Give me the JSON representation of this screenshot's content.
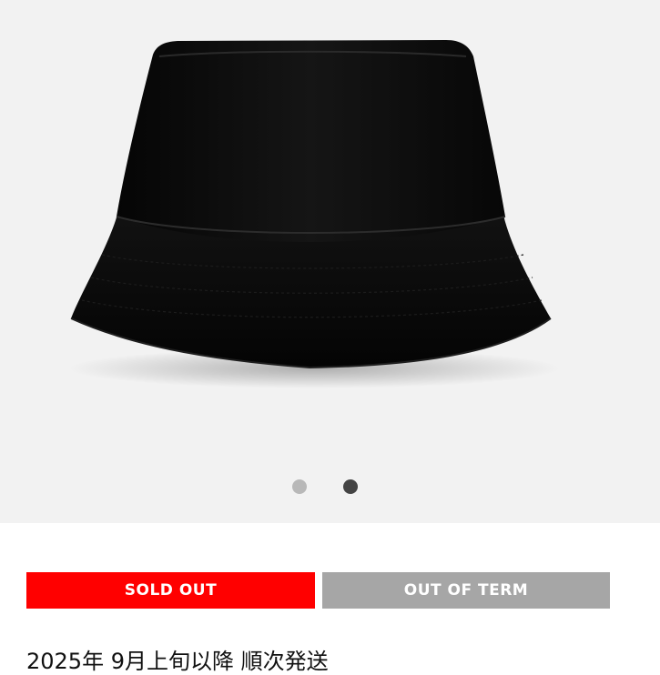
{
  "product": {
    "image_alt": "black bucket hat",
    "image_count": 2,
    "active_image_index": 1
  },
  "buttons": {
    "sold_out": "SOLD OUT",
    "out_of_term": "OUT OF TERM"
  },
  "description": {
    "shipping_note": "2025年 9月上旬以降 順次発送"
  },
  "colors": {
    "gallery_background": "#f2f2f2",
    "sold_out_bg": "#ff0000",
    "out_of_term_bg": "#a6a6a6",
    "dot_inactive": "#b8b8b8",
    "dot_active": "#444444",
    "hat": "#0a0a0a"
  }
}
